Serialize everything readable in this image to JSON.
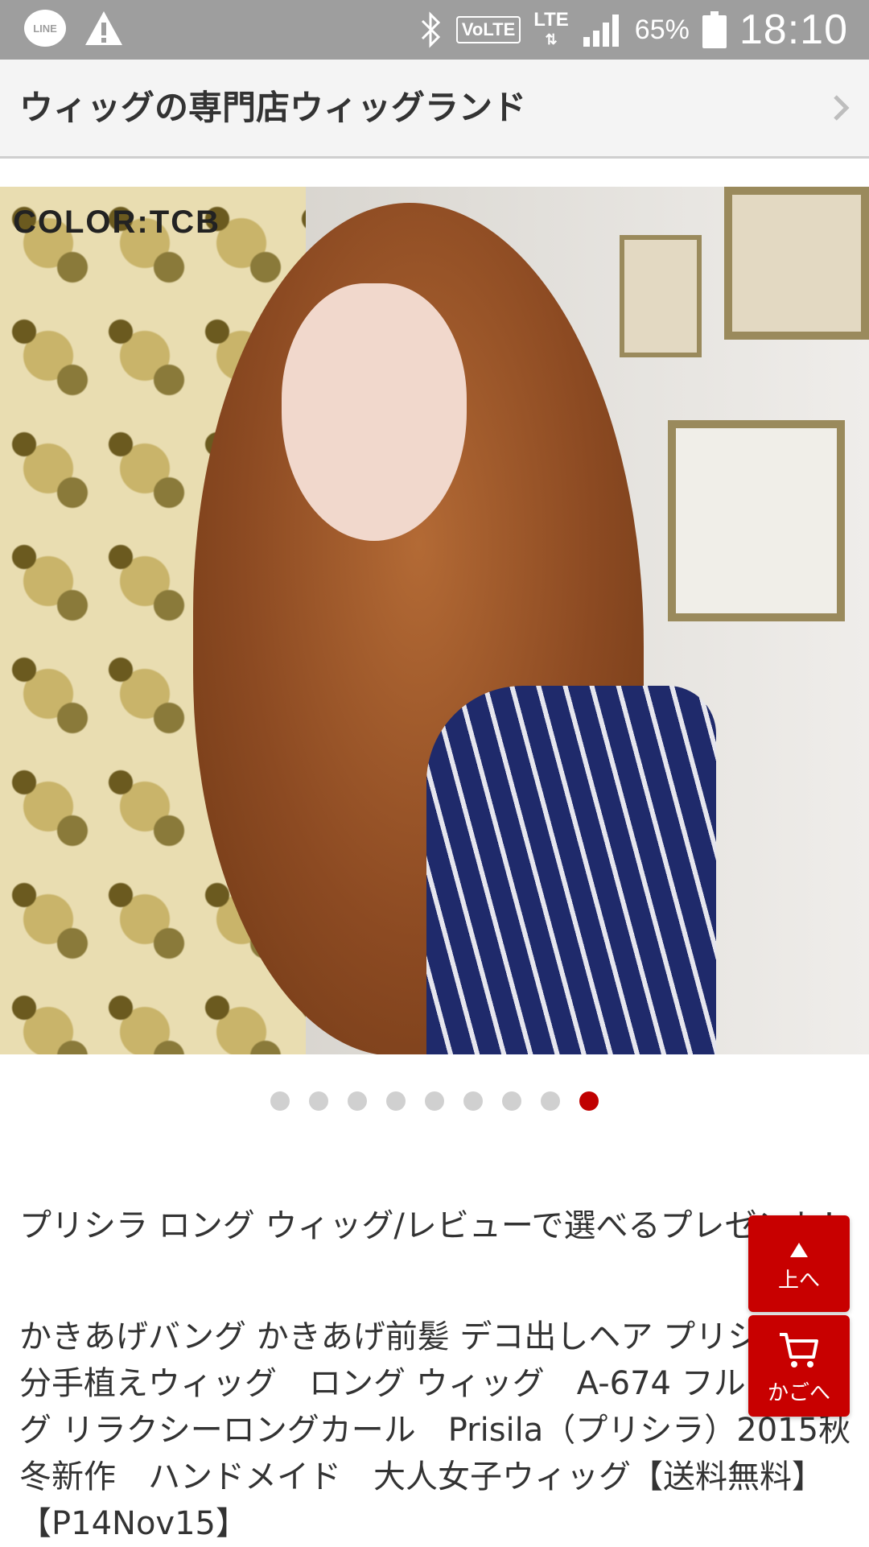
{
  "status_bar": {
    "line_label": "LINE",
    "volte_label": "VoLTE",
    "lte_label": "LTE",
    "battery_percent": "65%",
    "time": "18:10"
  },
  "header": {
    "shop_title": "ウィッグの専門店ウィッグランド"
  },
  "product_image": {
    "caption": "COLOR:TCB"
  },
  "carousel": {
    "dot_count": 9,
    "active_index": 8,
    "active_color": "#c00000",
    "inactive_color": "#d0d0d0"
  },
  "product": {
    "title": "プリシラ ロング ウィッグ/レビューで選べるプレゼント！",
    "description": "かきあげバング かきあげ前髪 デコ出しヘア プリシラ 部分手植えウィッグ　ロング ウィッグ　A-674 フルウィッグ リラクシーロングカール　Prisila（プリシラ）2015秋冬新作　ハンドメイド　大人女子ウィッグ【送料無料】【P14Nov15】"
  },
  "float_buttons": {
    "top_label": "上へ",
    "cart_label": "かごへ",
    "color": "#c80000"
  }
}
